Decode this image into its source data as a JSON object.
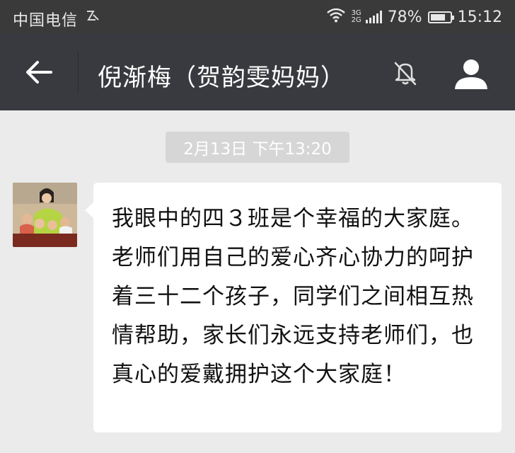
{
  "status_bar": {
    "carrier": "中国电信",
    "carrier_icon": "ℤ",
    "network_type_top": "3G",
    "network_type_bottom": "2G",
    "battery_percent": "78%",
    "battery_level": 0.78,
    "time": "15:12"
  },
  "nav": {
    "title": "倪渐梅（贺韵雯妈妈）",
    "back_icon": "back-arrow-icon",
    "mute_icon": "bell-muted-icon",
    "profile_icon": "person-icon"
  },
  "chat": {
    "timestamp": "2月13日 下午13:20",
    "messages": [
      {
        "sender": "left",
        "text": "我眼中的四３班是个幸福的大家庭。老师们用自己的爱心齐心协力的呵护着三十二个孩子，同学们之间相互热情帮助，家长们永远支持老师们，也真心的爱戴拥护这个大家庭！"
      }
    ]
  },
  "colors": {
    "status_bar_bg": "#3a3a3a",
    "nav_bg": "#393a3f",
    "chat_bg": "#ebebeb",
    "bubble_bg": "#ffffff",
    "timestamp_bg": "#d6d6d6"
  }
}
